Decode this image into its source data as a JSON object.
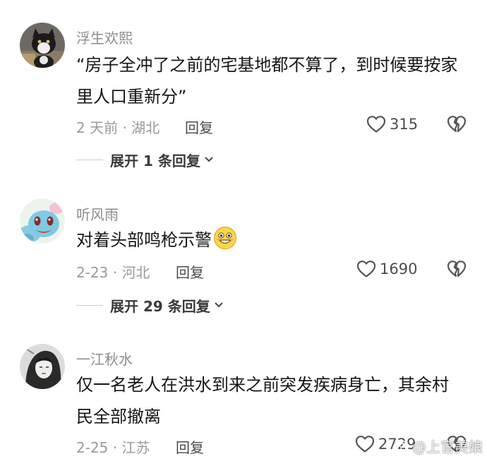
{
  "comments": [
    {
      "username": "浮生欢熙",
      "text": "“房子全冲了之前的宅基地都不算了，到时候要按家里人口重新分”",
      "meta": "2 天前 · 湖北",
      "reply_label": "回复",
      "likes": "315",
      "expand_label": "展开 1 条回复",
      "avatar_icon": "cat-avatar"
    },
    {
      "username": "听风雨",
      "text": "对着头部鸣枪示警",
      "emoji_icon": "grinning-face-emoji",
      "meta": "2-23 · 河北",
      "reply_label": "回复",
      "likes": "1690",
      "expand_label": "展开 29 条回复",
      "avatar_icon": "squirtle-avatar"
    },
    {
      "username": "一江秋水",
      "text": "仅一名老人在洪水到来之前突发疾病身亡，其余村民全部撤离",
      "meta": "2-25 · 江苏",
      "reply_label": "回复",
      "likes": "2729",
      "avatar_icon": "ink-portrait-avatar"
    }
  ],
  "icons": {
    "like": "heart-outline-icon",
    "dislike": "broken-heart-icon",
    "expand": "chevron-down-icon"
  },
  "watermark": {
    "text": "@上官美娘",
    "icon": "weibo-logo-icon"
  },
  "colors": {
    "username": "#8c8c8c",
    "body_text": "#161616",
    "meta": "#9a9a9a"
  }
}
